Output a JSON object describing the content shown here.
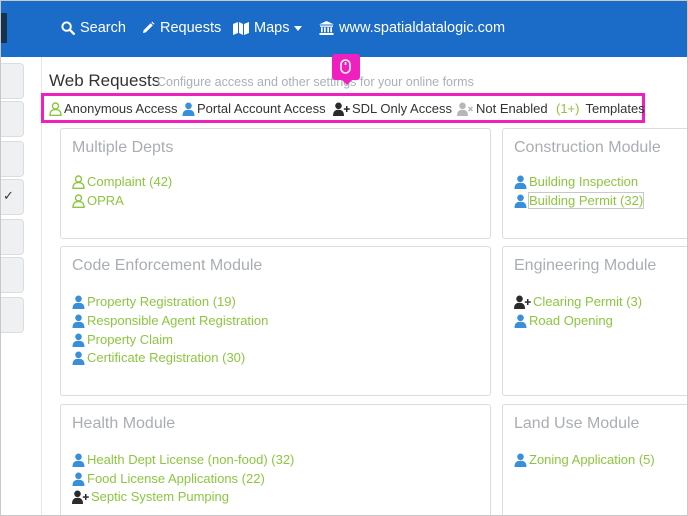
{
  "nav": {
    "search": "Search",
    "requests": "Requests",
    "maps": "Maps",
    "site": "www.spatialdatalogic.com"
  },
  "header": {
    "title": "Web Requests",
    "subtitle": "Configure access and other settings for your online forms"
  },
  "legend": {
    "anonymous": "Anonymous Access",
    "portal": "Portal Account Access",
    "sdl": "SDL Only Access",
    "not_enabled": "Not Enabled",
    "templates_badge": "(1+)",
    "templates": "Templates"
  },
  "cards": {
    "multiple_depts": {
      "title": "Multiple Depts",
      "items": [
        "Complaint (42)",
        "OPRA"
      ]
    },
    "construction": {
      "title": "Construction Module",
      "items": [
        "Building Inspection",
        "Building Permit (32)"
      ]
    },
    "code_enforcement": {
      "title": "Code Enforcement Module",
      "items": [
        "Property Registration (19)",
        "Responsible Agent Registration",
        "Property Claim",
        "Certificate Registration (30)"
      ]
    },
    "engineering": {
      "title": "Engineering Module",
      "items": [
        "Clearing Permit (3)",
        "Road Opening"
      ]
    },
    "health": {
      "title": "Health Module",
      "items": [
        "Health Dept License (non-food) (32)",
        "Food License Applications (22)",
        "Septic System Pumping"
      ]
    },
    "land_use": {
      "title": "Land Use Module",
      "items": [
        "Zoning Application (5)"
      ]
    }
  },
  "colors": {
    "nav_bg": "#1a6cc8",
    "link_green": "#8cc63f",
    "portal_blue": "#3a8fd9",
    "highlight_magenta": "#f020c0"
  },
  "icons": {
    "anonymous": "user-outline-icon",
    "portal": "user-solid-icon",
    "sdl": "user-plus-icon",
    "not_enabled": "user-times-icon"
  }
}
